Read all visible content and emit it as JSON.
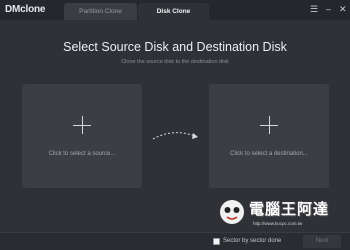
{
  "app": {
    "title": "DMclone"
  },
  "tabs": [
    {
      "label": "Partition Clone",
      "active": false
    },
    {
      "label": "Disk Clone",
      "active": true
    }
  ],
  "window_controls": {
    "menu_icon": "hamburger-icon",
    "minimize_icon": "minimize-icon",
    "close_icon": "close-icon"
  },
  "main": {
    "title": "Select Source Disk and Destination Disk",
    "subtitle": "Clone the source disk to the destination disk",
    "source_card": {
      "label": "Click to select a source..."
    },
    "destination_card": {
      "label": "Click to select a destination..."
    }
  },
  "footer": {
    "sector_checkbox": {
      "label": "Sector by sector done",
      "checked": false
    },
    "next_label": "Next"
  },
  "watermark": {
    "title": "電腦王阿達",
    "url": "http://www.kocpc.com.tw"
  },
  "colors": {
    "background": "#2f3137",
    "card": "#3b3e45",
    "titlebar": "#25272c"
  }
}
